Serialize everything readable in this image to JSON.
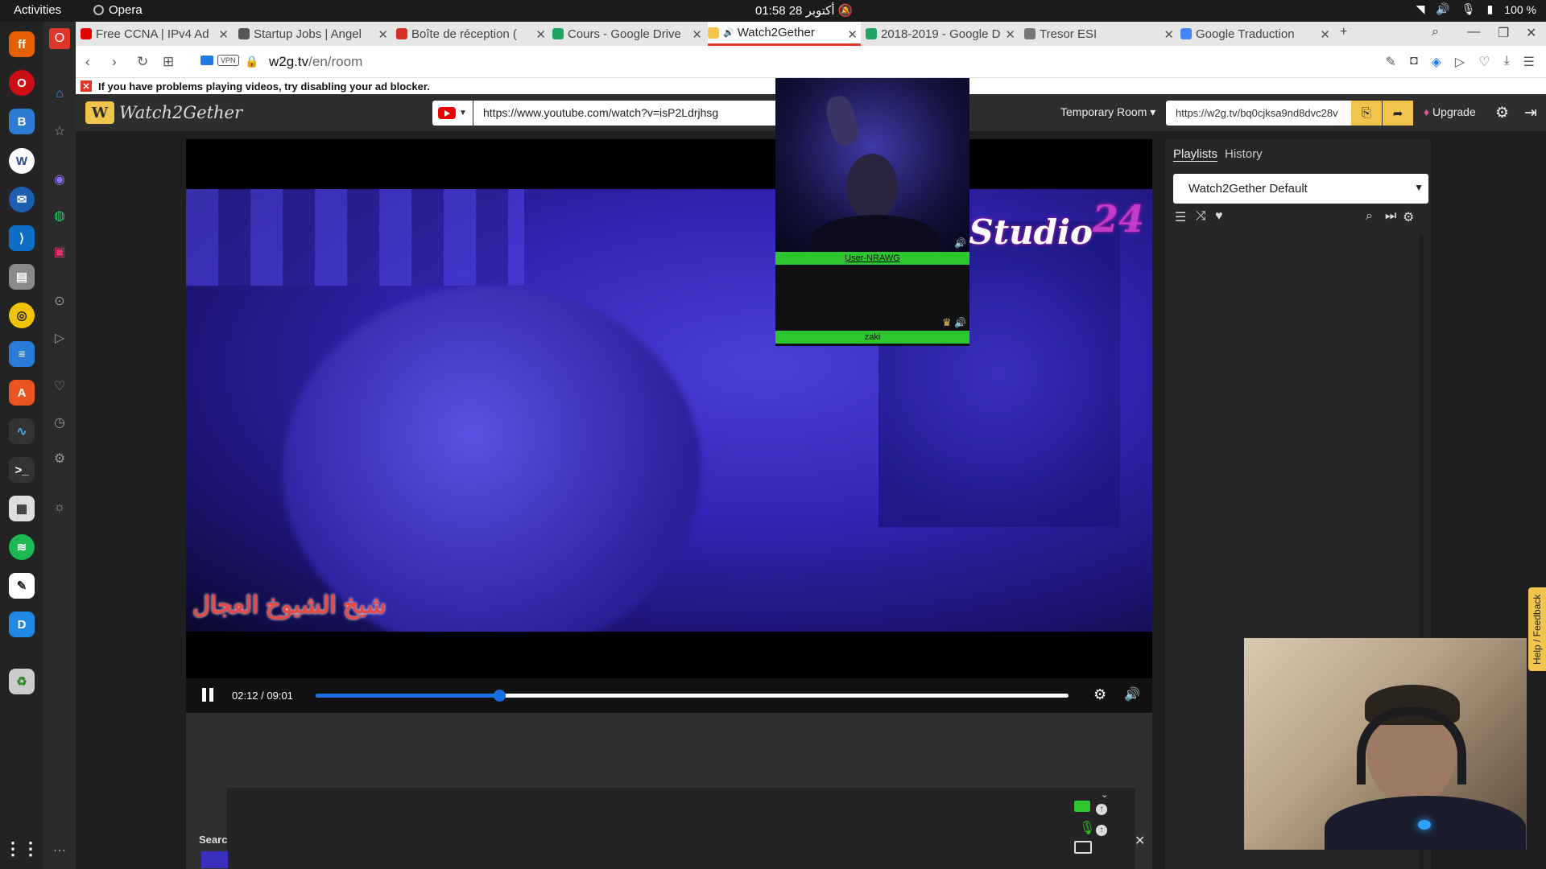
{
  "system": {
    "activities": "Activities",
    "app_name": "Opera",
    "clock": "01:58  28 أكتوبر",
    "battery": "100 %"
  },
  "tabs": [
    {
      "title": "Free CCNA | IPv4 Ad",
      "color": "#e00000",
      "active": false
    },
    {
      "title": "Startup Jobs | Angel",
      "color": "#555555",
      "active": false
    },
    {
      "title": "Boîte de réception (",
      "color": "#d93025",
      "active": false
    },
    {
      "title": "Cours - Google Drive",
      "color": "#1fa463",
      "active": false
    },
    {
      "title": "Watch2Gether",
      "color": "#f1c44c",
      "active": true
    },
    {
      "title": "2018-2019 - Google D",
      "color": "#1fa463",
      "active": false
    },
    {
      "title": "Tresor ESI",
      "color": "#777777",
      "active": false
    },
    {
      "title": "Google Traduction",
      "color": "#4285f4",
      "active": false
    }
  ],
  "address": {
    "vpn": "VPN",
    "host": "w2g.tv",
    "path": "/en/room"
  },
  "warning": "If you have problems playing videos, try disabling your ad blocker.",
  "w2g": {
    "logo": "Watch2Gether",
    "video_url": "https://www.youtube.com/watch?v=isP2Ldrjhsg",
    "room": "Temporary Room ▾",
    "share_url": "https://w2g.tv/bq0cjksa9nd8dvc28v",
    "upgrade": "Upgrade"
  },
  "video": {
    "watermark_main": "Studio",
    "watermark_num": "24",
    "subtitle": "شيخ الشيوخ العجال",
    "time": "02:12 / 09:01",
    "progress": 0.244
  },
  "cams": [
    {
      "name": "User-NRAWG"
    },
    {
      "name": "zaki"
    }
  ],
  "playlist": {
    "tab_playlists": "Playlists",
    "tab_history": "History",
    "selected": "Watch2Gether Default"
  },
  "search_label": "Searc",
  "help": "Help / Feedback",
  "colors": {
    "accent": "#f1c44c",
    "cam_label": "#2ec62e",
    "progress": "#1a6fe0",
    "tab_active_border": "#e0362a"
  }
}
